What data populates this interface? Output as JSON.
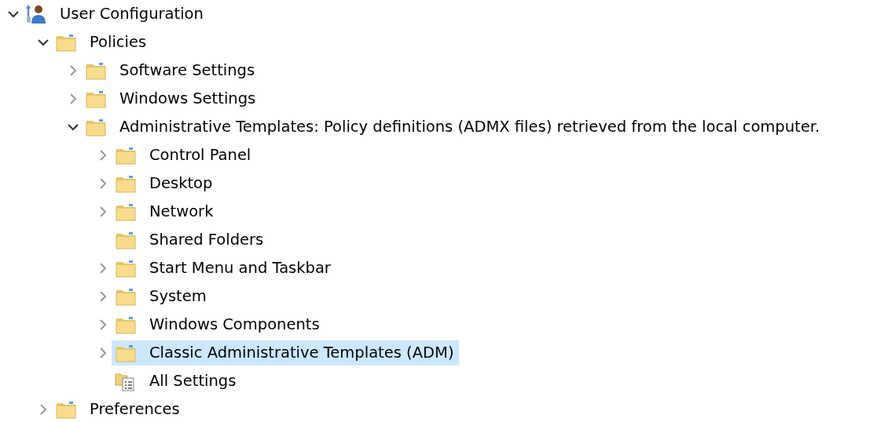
{
  "tree": [
    {
      "label": "User Configuration",
      "kind": "user",
      "expanded": true,
      "selected": false,
      "children": [
        {
          "label": "Policies",
          "kind": "folder",
          "expanded": true,
          "selected": false,
          "children": [
            {
              "label": "Software Settings",
              "kind": "folder",
              "expanded": false,
              "selected": false
            },
            {
              "label": "Windows Settings",
              "kind": "folder",
              "expanded": false,
              "selected": false
            },
            {
              "label": "Administrative Templates: Policy definitions (ADMX files) retrieved from the local computer.",
              "kind": "folder",
              "expanded": true,
              "selected": false,
              "children": [
                {
                  "label": "Control Panel",
                  "kind": "folder",
                  "expanded": false,
                  "selected": false
                },
                {
                  "label": "Desktop",
                  "kind": "folder",
                  "expanded": false,
                  "selected": false
                },
                {
                  "label": "Network",
                  "kind": "folder",
                  "expanded": false,
                  "selected": false
                },
                {
                  "label": "Shared Folders",
                  "kind": "folder",
                  "selected": false
                },
                {
                  "label": "Start Menu and Taskbar",
                  "kind": "folder",
                  "expanded": false,
                  "selected": false
                },
                {
                  "label": "System",
                  "kind": "folder",
                  "expanded": false,
                  "selected": false
                },
                {
                  "label": "Windows Components",
                  "kind": "folder",
                  "expanded": false,
                  "selected": false
                },
                {
                  "label": "Classic Administrative Templates (ADM)",
                  "kind": "folder",
                  "expanded": false,
                  "selected": true
                },
                {
                  "label": "All Settings",
                  "kind": "settings",
                  "selected": false
                }
              ]
            }
          ]
        },
        {
          "label": "Preferences",
          "kind": "folder",
          "expanded": false,
          "selected": false
        }
      ]
    }
  ]
}
